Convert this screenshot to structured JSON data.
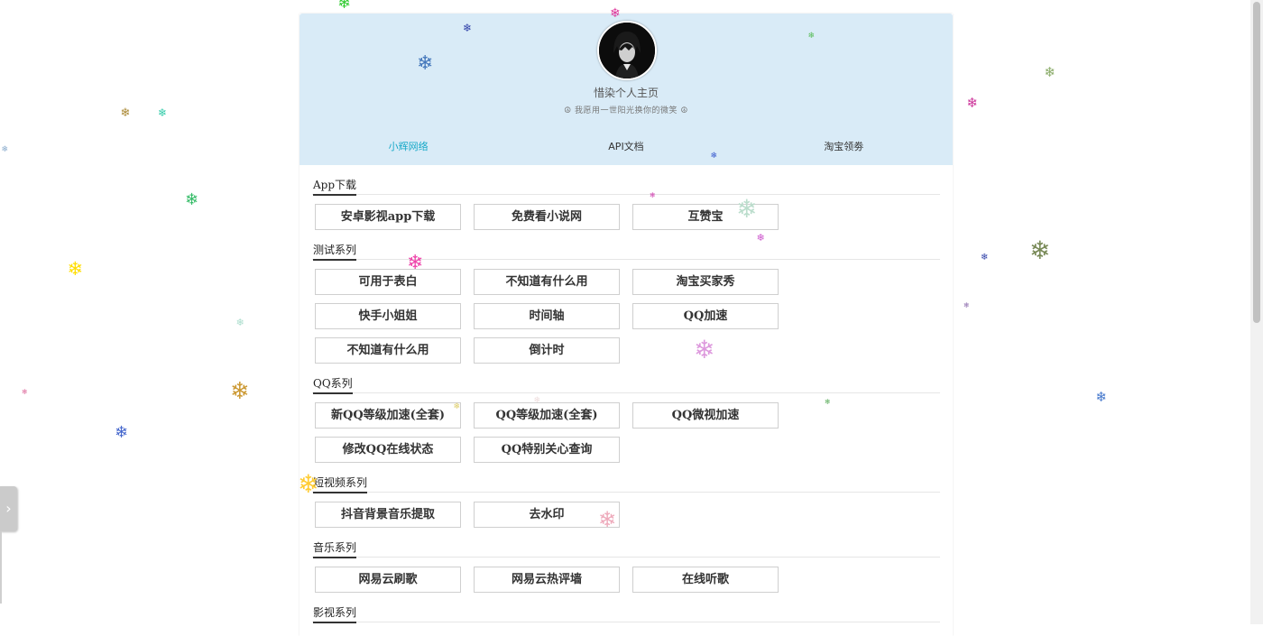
{
  "header": {
    "title": "惜染个人主页",
    "subtitle": "☮ 我愿用一世阳光换你的微笑 ☮",
    "nav": [
      "小辉网络",
      "API文档",
      "淘宝领劵"
    ],
    "avatar_icon": "avatar-photo"
  },
  "sections": [
    {
      "title": "App下载",
      "items": [
        "安卓影视app下载",
        "免费看小说网",
        "互赞宝"
      ]
    },
    {
      "title": "测试系列",
      "items": [
        "可用于表白",
        "不知道有什么用",
        "淘宝买家秀",
        "快手小姐姐",
        "时间轴",
        "QQ加速",
        "不知道有什么用",
        "倒计时"
      ]
    },
    {
      "title": "QQ系列",
      "items": [
        "新QQ等级加速(全套)",
        "QQ等级加速(全套)",
        "QQ微视加速",
        "修改QQ在线状态",
        "QQ特别关心查询"
      ]
    },
    {
      "title": "短视频系列",
      "items": [
        "抖音背景音乐提取",
        "去水印"
      ]
    },
    {
      "title": "音乐系列",
      "items": [
        "网易云刷歌",
        "网易云热评墙",
        "在线听歌"
      ]
    },
    {
      "title": "影视系列",
      "items": []
    }
  ],
  "side_tab_icon": "chevron-right-icon",
  "snowflake_icon": "snowflake-icon",
  "colors": {
    "header_bg": "#d9ebf7",
    "nav_active": "#18a9c8"
  }
}
